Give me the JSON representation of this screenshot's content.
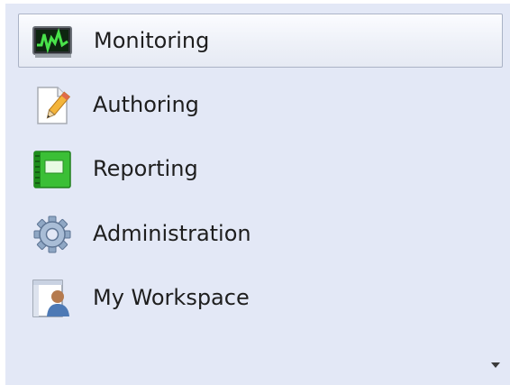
{
  "nav": {
    "items": [
      {
        "label": "Monitoring",
        "icon": "monitoring-icon",
        "selected": true
      },
      {
        "label": "Authoring",
        "icon": "authoring-icon",
        "selected": false
      },
      {
        "label": "Reporting",
        "icon": "reporting-icon",
        "selected": false
      },
      {
        "label": "Administration",
        "icon": "administration-icon",
        "selected": false
      },
      {
        "label": "My Workspace",
        "icon": "my-workspace-icon",
        "selected": false
      }
    ],
    "overflow_icon": "chevron-down-icon"
  },
  "colors": {
    "pane_background": "#e3e8f6",
    "selected_border": "#aab3c6",
    "label_text": "#1e1e1e"
  }
}
